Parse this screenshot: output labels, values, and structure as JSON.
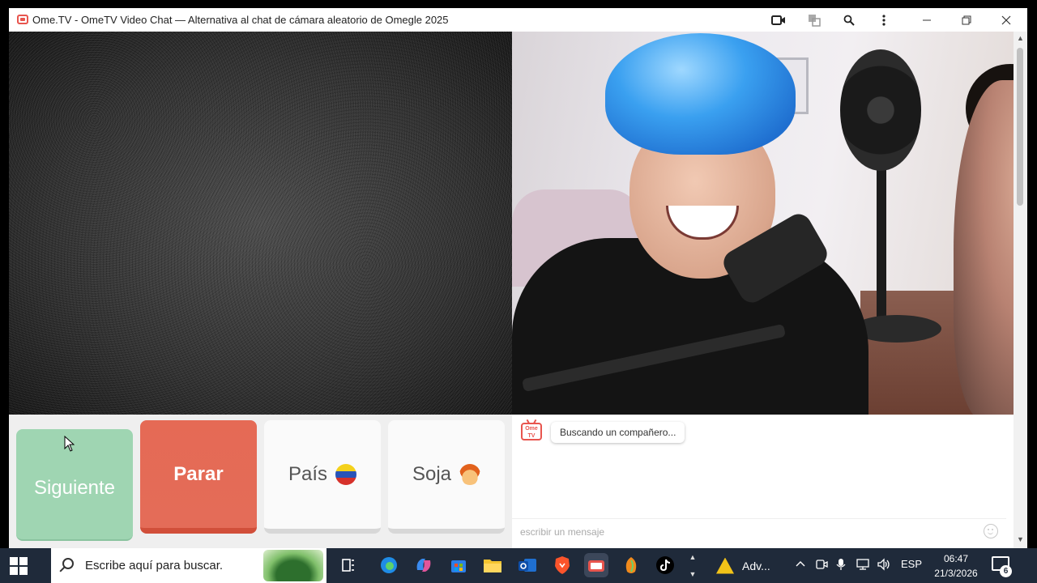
{
  "window": {
    "title": "Ome.TV - OmeTV Video Chat — Alternativa al chat de cámara aleatorio de Omegle 2025",
    "icons": [
      "camera-icon",
      "translate-icon",
      "zoom-icon",
      "more-icon",
      "minimize-icon",
      "restore-icon",
      "close-icon"
    ]
  },
  "controls": {
    "next_label": "Siguiente",
    "stop_label": "Parar",
    "country_label": "País",
    "gender_label": "Soja",
    "colors": {
      "next": "#9fd5b2",
      "stop": "#e46c58"
    }
  },
  "chat": {
    "logo_text": "Ome TV",
    "status_message": "Buscando un compañero...",
    "input_placeholder": "escribir un mensaje"
  },
  "taskbar": {
    "search_placeholder": "Escribe aquí para buscar.",
    "apps": [
      "task-view-icon",
      "edge-icon",
      "copilot-icon",
      "store-icon",
      "file-explorer-icon",
      "outlook-icon",
      "brave-icon",
      "ometv-app-icon",
      "fl-studio-icon",
      "tiktok-icon"
    ],
    "antivirus_label": "Adv...",
    "language": "ESP",
    "time": "06:47",
    "date": "21/3/2026",
    "notification_count": "6"
  }
}
